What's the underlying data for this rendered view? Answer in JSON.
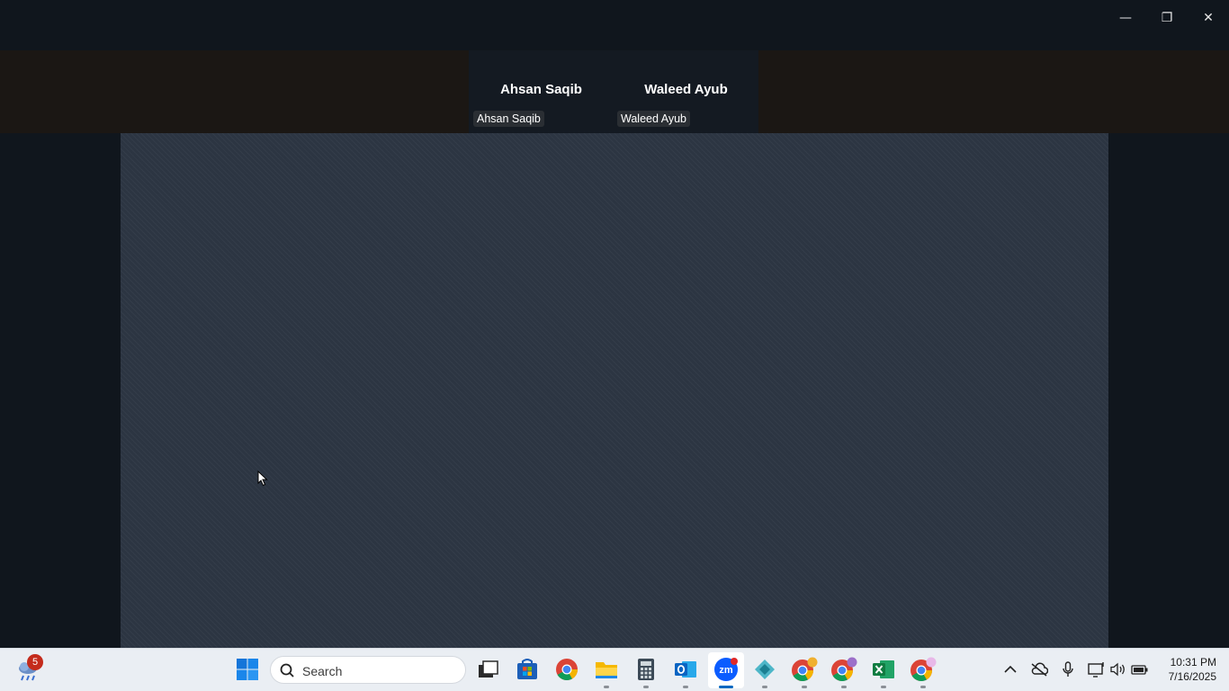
{
  "window": {
    "controls": {
      "minimize": "—",
      "restore": "❐",
      "close": "✕"
    }
  },
  "participants": [
    {
      "name": "Ahsan Saqib",
      "tag": "Ahsan Saqib"
    },
    {
      "name": "Waleed Ayub",
      "tag": "Waleed Ayub"
    }
  ],
  "taskbar": {
    "weather_badge": "5",
    "search_placeholder": "Search",
    "zoom_label": "zm",
    "clock": {
      "time": "10:31 PM",
      "date": "7/16/2025"
    },
    "icons": [
      "windows-start-icon",
      "search-icon",
      "task-view-icon",
      "microsoft-store-icon",
      "chrome-icon",
      "file-explorer-icon",
      "calculator-icon",
      "outlook-icon",
      "zoom-icon",
      "app-icon",
      "chrome-profile-icon",
      "chrome-profile-icon",
      "excel-icon",
      "chrome-profile-icon"
    ],
    "tray": [
      "chevron-up-icon",
      "onedrive-offline-icon",
      "microphone-icon",
      "network-icon",
      "volume-icon",
      "battery-icon"
    ]
  },
  "colors": {
    "share_bg": "#2c3542",
    "taskbar_bg": "#eaeef3",
    "accent": "#0067c0",
    "badge": "#c42b1c"
  }
}
